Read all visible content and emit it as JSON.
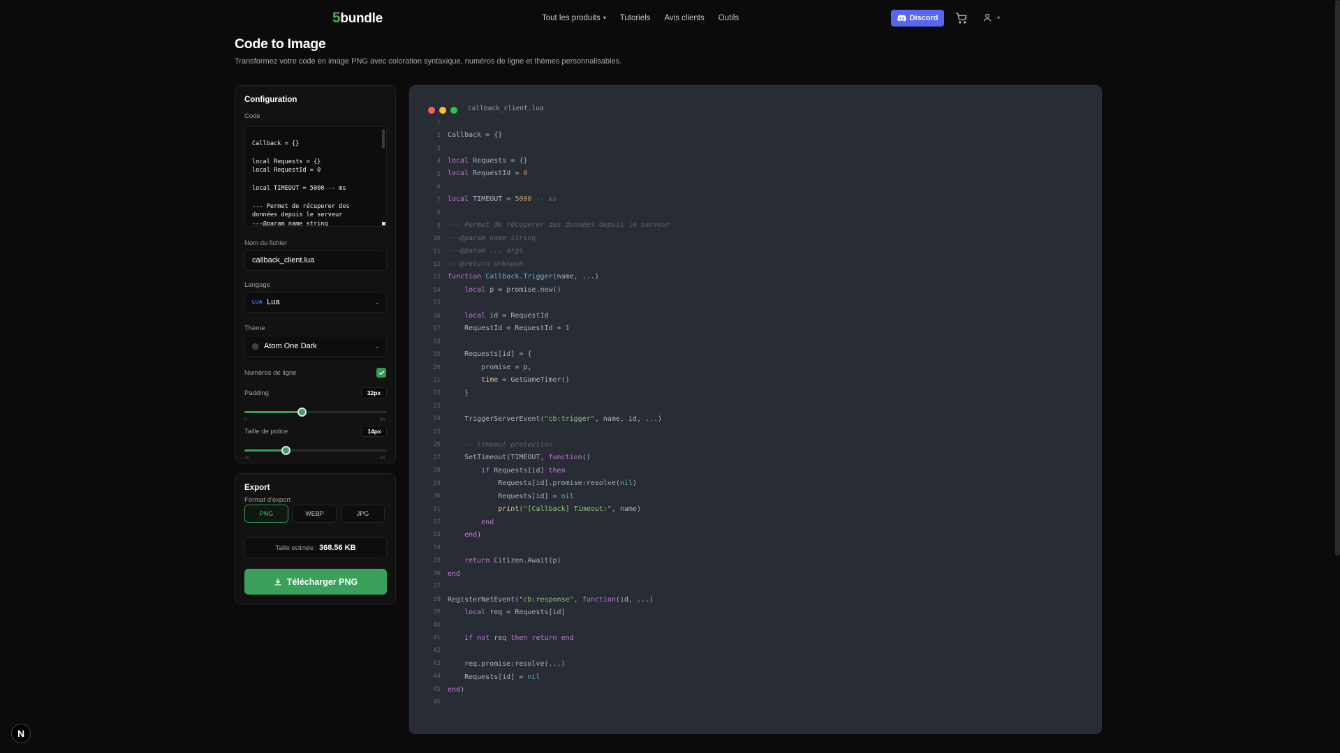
{
  "nav": {
    "logo_number": "5",
    "logo_text": "bundle",
    "links": [
      "Tout les produits",
      "Tutoriels",
      "Avis clients",
      "Outils"
    ],
    "discord_label": "Discord"
  },
  "page": {
    "title": "Code to Image",
    "subtitle": "Transformez votre code en image PNG avec coloration syntaxique, numéros de ligne et thèmes personnalisables."
  },
  "config": {
    "title": "Configuration",
    "code_label": "Code",
    "code_value": "Callback = {}\n\nlocal Requests = {}\nlocal RequestId = 0\n\nlocal TIMEOUT = 5000 -- ms\n\n--- Permet de récuperer des\ndonnées depuis le serveur\n---@param name string",
    "filename_label": "Nom du fichier",
    "filename_value": "callback_client.lua",
    "language_label": "Langage",
    "language_tag": "LUA",
    "language_value": "Lua",
    "theme_label": "Thème",
    "theme_value": "Atom One Dark",
    "line_numbers_label": "Numéros de ligne",
    "line_numbers_enabled": true,
    "padding_label": "Padding",
    "padding_value": "32px",
    "padding_min": "0",
    "padding_max": "80",
    "padding_fraction": 0.4,
    "font_size_label": "Taille de police",
    "font_size_value": "14px",
    "font_size_min": "10",
    "font_size_max": "24",
    "font_size_fraction": 0.29
  },
  "export": {
    "title": "Export",
    "format_label": "Format d'export",
    "formats": [
      "PNG",
      "WEBP",
      "JPG"
    ],
    "selected_format": "PNG",
    "size_label": "Taille estimée :",
    "size_value": "368.56 KB",
    "download_label": "Télécharger PNG"
  },
  "preview": {
    "filename": "callback_client.lua",
    "window_dot_colors": [
      "#ff5f56",
      "#ffbd2e",
      "#27c93f"
    ],
    "line_count": 46
  },
  "colors": {
    "accent": "#3aa05b",
    "discord": "#5865f2",
    "editor_bg": "#282c34"
  },
  "corner_badge": "N"
}
